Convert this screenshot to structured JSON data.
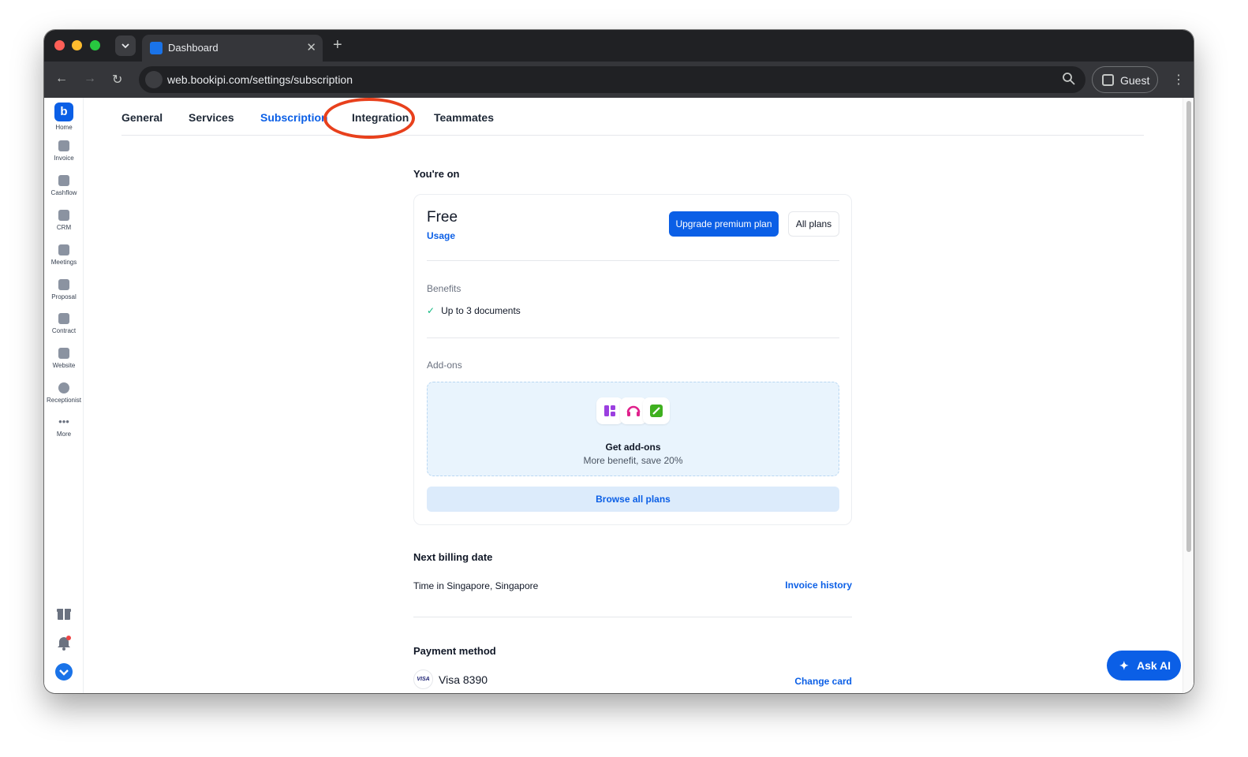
{
  "browser": {
    "tab_title": "Dashboard",
    "url": "web.bookipi.com/settings/subscription",
    "profile_label": "Guest"
  },
  "sidebar": {
    "items": [
      {
        "label": "Home",
        "icon": "home-logo-icon"
      },
      {
        "label": "Invoice",
        "icon": "invoice-icon"
      },
      {
        "label": "Cashflow",
        "icon": "cashflow-icon"
      },
      {
        "label": "CRM",
        "icon": "crm-icon"
      },
      {
        "label": "Meetings",
        "icon": "meetings-icon"
      },
      {
        "label": "Proposal",
        "icon": "proposal-icon"
      },
      {
        "label": "Contract",
        "icon": "contract-icon"
      },
      {
        "label": "Website",
        "icon": "website-icon"
      },
      {
        "label": "Receptionist",
        "icon": "receptionist-icon"
      },
      {
        "label": "More",
        "icon": "more-icon"
      }
    ]
  },
  "settings_tabs": [
    "General",
    "Services",
    "Subscription",
    "Integration",
    "Teammates"
  ],
  "active_tab": "Subscription",
  "subscription": {
    "heading": "You're on",
    "plan_name": "Free",
    "usage_link": "Usage",
    "upgrade_button": "Upgrade premium plan",
    "all_plans_button": "All plans",
    "benefits_label": "Benefits",
    "benefits": [
      "Up to 3 documents"
    ],
    "addons_label": "Add-ons",
    "addons_title": "Get add-ons",
    "addons_subtitle": "More benefit, save 20%",
    "browse_button": "Browse all plans"
  },
  "billing": {
    "heading": "Next billing date",
    "timezone_text": "Time in Singapore, Singapore",
    "invoice_history_link": "Invoice history"
  },
  "payment": {
    "heading": "Payment method",
    "card_brand": "VISA",
    "card_text": "Visa 8390",
    "change_card_link": "Change card"
  },
  "ask_ai": {
    "label": "Ask AI"
  },
  "colors": {
    "brand": "#0b5fe6",
    "annotation": "#e8401c"
  }
}
